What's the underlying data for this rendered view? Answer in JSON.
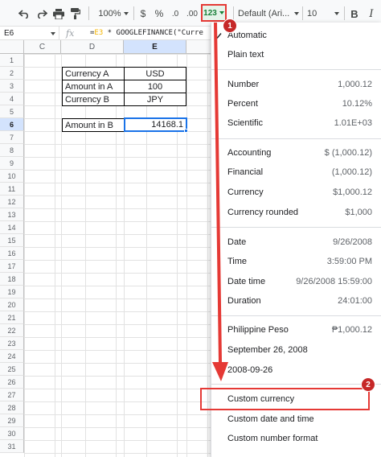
{
  "toolbar": {
    "undo_icon": "undo-icon",
    "redo_icon": "redo-icon",
    "print_icon": "print-icon",
    "paint_format_icon": "paint-format-icon",
    "zoom": "100%",
    "currency_symbol": "$",
    "percent_symbol": "%",
    "decrease_decimal": ".0",
    "increase_decimal": ".00",
    "more_formats_label": "123",
    "font": "Default (Ari...",
    "font_size": "10",
    "bold": "B",
    "italic": "I"
  },
  "formula_bar": {
    "cell_ref": "E6",
    "fx": "fx",
    "formula_prefix": "=",
    "formula_ref": "E3",
    "formula_rest": " * GOOGLEFINANCE(\"Curre"
  },
  "columns": [
    "C",
    "D",
    "E"
  ],
  "rows": [
    "1",
    "2",
    "3",
    "4",
    "5",
    "6",
    "7",
    "8",
    "9",
    "10",
    "11",
    "12",
    "13",
    "14",
    "15",
    "16",
    "17",
    "18",
    "19",
    "20",
    "21",
    "22",
    "23",
    "24",
    "25",
    "26",
    "27",
    "28",
    "29",
    "30",
    "31"
  ],
  "cells": {
    "d2": "Currency A",
    "e2": "USD",
    "d3": "Amount in A",
    "e3": "100",
    "d4": "Currency B",
    "e4": "JPY",
    "d6": "Amount in B",
    "e6": "14168.1"
  },
  "menu": {
    "automatic": "Automatic",
    "plain_text": "Plain text",
    "number": "Number",
    "number_val": "1,000.12",
    "percent": "Percent",
    "percent_val": "10.12%",
    "scientific": "Scientific",
    "scientific_val": "1.01E+03",
    "accounting": "Accounting",
    "accounting_val": "$ (1,000.12)",
    "financial": "Financial",
    "financial_val": "(1,000.12)",
    "currency": "Currency",
    "currency_val": "$1,000.12",
    "currency_rounded": "Currency rounded",
    "currency_rounded_val": "$1,000",
    "date": "Date",
    "date_val": "9/26/2008",
    "time": "Time",
    "time_val": "3:59:00 PM",
    "date_time": "Date time",
    "date_time_val": "9/26/2008 15:59:00",
    "duration": "Duration",
    "duration_val": "24:01:00",
    "peso": "Philippine Peso",
    "peso_val": "₱1,000.12",
    "long_date": "September 26, 2008",
    "iso_date": "2008-09-26",
    "custom_currency": "Custom currency",
    "custom_date_time": "Custom date and time",
    "custom_number_format": "Custom number format"
  },
  "annotations": {
    "step1": "1",
    "step2": "2"
  },
  "colors": {
    "annotation_red": "#e53935",
    "selection_blue": "#1a73e8"
  }
}
